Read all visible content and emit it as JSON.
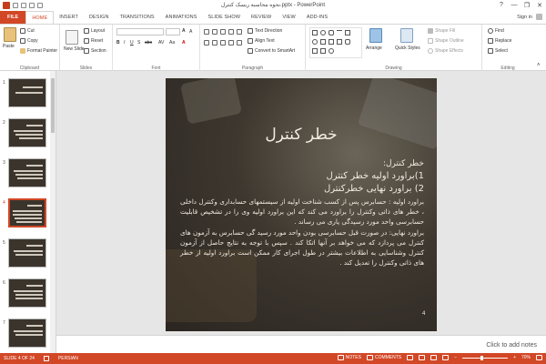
{
  "window": {
    "title": "نحوه محاسبه ریسک کنترل.pptx - PowerPoint",
    "min": "—",
    "max": "❐",
    "close": "✕"
  },
  "tabs": [
    "FILE",
    "HOME",
    "INSERT",
    "DESIGN",
    "TRANSITIONS",
    "ANIMATIONS",
    "SLIDE SHOW",
    "REVIEW",
    "VIEW",
    "ADD-INS"
  ],
  "signin": "Sign in",
  "ribbon": {
    "clipboard": {
      "label": "Clipboard",
      "paste": "Paste",
      "cut": "Cut",
      "copy": "Copy",
      "format_painter": "Format Painter"
    },
    "slides": {
      "label": "Slides",
      "new_slide": "New Slide",
      "layout": "Layout",
      "reset": "Reset",
      "section": "Section"
    },
    "font": {
      "label": "Font"
    },
    "paragraph": {
      "label": "Paragraph",
      "text_direction": "Text Direction",
      "align_text": "Align Text",
      "convert_smartart": "Convert to SmartArt"
    },
    "drawing": {
      "label": "Drawing",
      "arrange": "Arrange",
      "quick_styles": "Quick Styles",
      "shape_fill": "Shape Fill",
      "shape_outline": "Shape Outline",
      "shape_effects": "Shape Effects"
    },
    "editing": {
      "label": "Editing",
      "find": "Find",
      "replace": "Replace",
      "select": "Select"
    }
  },
  "thumbnails": [
    {
      "num": "1"
    },
    {
      "num": "2"
    },
    {
      "num": "3"
    },
    {
      "num": "4"
    },
    {
      "num": "5"
    },
    {
      "num": "6"
    },
    {
      "num": "7"
    }
  ],
  "slide": {
    "title": "خطر کنترل",
    "heading": "خطر کنترل:",
    "items": [
      "1)براورد اولیه خطر کنترل",
      "2) براورد نهایی خطرکنترل"
    ],
    "para1": "براورد اولیه : حسابرس پس از کسب شناخت اولیه از سیستمهای حسابداری وکنترل داخلی ، خطر های ذاتی وکنترل را براورد می کند که این براورد اولیه وی را در تشخیص قابلیت حسابرسی واحد مورد رسیدگی یاری می رساند .",
    "para2": "براورد نهایی: در صورت قبل حسابرسی بودن واحد مورد رسید گی حسابرس به آزمون های کنترل می پردازد که می خواهد بر آنها اتکا کند . سپس با توجه به نتایج حاصل از آزمون کنترل وشناسایی به اطلاعات بیشتر در طول اجرای کار ممکن است براورد اولیه از خطر های ذاتی وکنترل را تعدیل کند .",
    "number": "4"
  },
  "notes_placeholder": "Click to add notes",
  "status": {
    "slide_info": "SLIDE 4 OF 24",
    "language": "PERSIAN",
    "notes": "NOTES",
    "comments": "COMMENTS",
    "zoom": "70%"
  },
  "colors": {
    "accent": "#d24726"
  }
}
